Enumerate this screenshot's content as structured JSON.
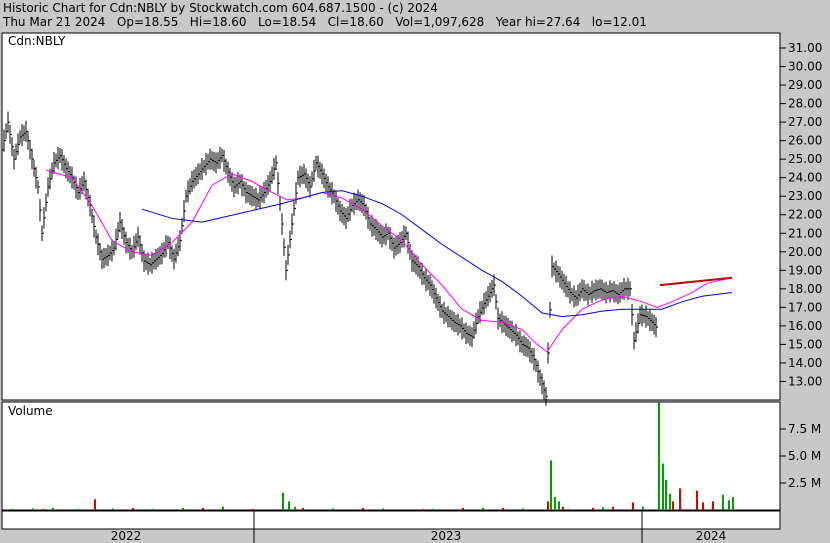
{
  "header": {
    "line1": "Historic Chart for Cdn:NBLY by Stockwatch.com 604.687.1500 - (c) 2024",
    "line2": "Thu Mar 21 2024   Op=18.55   Hi=18.60   Lo=18.54   Cl=18.60   Vol=1,097,628   Year hi=27.64   lo=12.01"
  },
  "panels": {
    "symbol": "Cdn:NBLY",
    "volume_label": "Volume"
  },
  "colors": {
    "background": "#c8c8c8",
    "panel": "#ffffff",
    "price_bars": "#000000",
    "ma_short": "#ff00ff",
    "ma_long": "#0000ff",
    "volume_up": "#00a000",
    "volume_down": "#e00000",
    "recent_range": "#c00000"
  },
  "chart_data": {
    "type": "bar",
    "title": "Historic Chart for Cdn:NBLY",
    "series": [
      {
        "kind": "ohlc",
        "points_xy": [
          [
            0,
            25.5
          ],
          [
            6,
            27.0
          ],
          [
            12,
            25.0
          ],
          [
            18,
            26.2
          ],
          [
            24,
            26.5
          ],
          [
            30,
            25.0
          ],
          [
            36,
            23.5
          ],
          [
            40,
            21.0
          ],
          [
            46,
            23.5
          ],
          [
            52,
            24.8
          ],
          [
            58,
            25.2
          ],
          [
            64,
            24.5
          ],
          [
            70,
            24.0
          ],
          [
            76,
            23.2
          ],
          [
            82,
            23.8
          ],
          [
            88,
            22.5
          ],
          [
            94,
            20.8
          ],
          [
            100,
            19.6
          ],
          [
            106,
            19.8
          ],
          [
            112,
            20.2
          ],
          [
            118,
            21.6
          ],
          [
            124,
            20.5
          ],
          [
            130,
            20.0
          ],
          [
            136,
            20.8
          ],
          [
            142,
            19.5
          ],
          [
            148,
            19.3
          ],
          [
            154,
            19.6
          ],
          [
            160,
            19.9
          ],
          [
            166,
            20.5
          ],
          [
            172,
            19.6
          ],
          [
            178,
            20.6
          ],
          [
            184,
            23.0
          ],
          [
            190,
            23.8
          ],
          [
            196,
            24.2
          ],
          [
            202,
            24.6
          ],
          [
            208,
            25.0
          ],
          [
            214,
            24.8
          ],
          [
            220,
            25.2
          ],
          [
            226,
            24.3
          ],
          [
            232,
            23.5
          ],
          [
            238,
            23.8
          ],
          [
            244,
            23.2
          ],
          [
            250,
            23.0
          ],
          [
            256,
            22.8
          ],
          [
            262,
            23.2
          ],
          [
            268,
            23.8
          ],
          [
            274,
            24.8
          ],
          [
            280,
            21.5
          ],
          [
            284,
            19.0
          ],
          [
            290,
            21.5
          ],
          [
            296,
            24.0
          ],
          [
            302,
            24.2
          ],
          [
            308,
            23.5
          ],
          [
            314,
            24.8
          ],
          [
            320,
            24.2
          ],
          [
            326,
            23.5
          ],
          [
            332,
            23.0
          ],
          [
            338,
            22.2
          ],
          [
            344,
            21.8
          ],
          [
            350,
            22.5
          ],
          [
            356,
            22.8
          ],
          [
            362,
            22.5
          ],
          [
            368,
            21.5
          ],
          [
            374,
            21.2
          ],
          [
            380,
            20.8
          ],
          [
            386,
            21.0
          ],
          [
            392,
            20.2
          ],
          [
            398,
            20.5
          ],
          [
            404,
            21.0
          ],
          [
            410,
            19.5
          ],
          [
            416,
            19.2
          ],
          [
            422,
            18.6
          ],
          [
            428,
            18.2
          ],
          [
            434,
            17.5
          ],
          [
            440,
            16.8
          ],
          [
            446,
            16.5
          ],
          [
            452,
            16.2
          ],
          [
            458,
            16.0
          ],
          [
            464,
            15.6
          ],
          [
            470,
            15.4
          ],
          [
            476,
            16.5
          ],
          [
            482,
            17.2
          ],
          [
            488,
            17.8
          ],
          [
            492,
            18.2
          ],
          [
            496,
            16.4
          ],
          [
            502,
            16.1
          ],
          [
            508,
            15.8
          ],
          [
            514,
            15.5
          ],
          [
            520,
            15.0
          ],
          [
            526,
            14.8
          ],
          [
            532,
            14.2
          ],
          [
            538,
            13.2
          ],
          [
            544,
            12.2
          ],
          [
            550,
            19.2
          ],
          [
            556,
            18.8
          ],
          [
            562,
            18.3
          ],
          [
            568,
            17.8
          ],
          [
            574,
            17.5
          ],
          [
            580,
            18.0
          ],
          [
            586,
            17.7
          ],
          [
            592,
            17.9
          ],
          [
            598,
            18.0
          ],
          [
            604,
            17.8
          ],
          [
            610,
            17.9
          ],
          [
            616,
            17.7
          ],
          [
            622,
            18.0
          ],
          [
            628,
            18.0
          ],
          [
            632,
            15.2
          ],
          [
            638,
            16.6
          ],
          [
            644,
            16.5
          ],
          [
            650,
            16.2
          ],
          [
            656,
            15.8
          ]
        ]
      },
      {
        "name": "",
        "kind": "moving_average_short",
        "points_xy": [
          [
            44,
            24.4
          ],
          [
            70,
            24.0
          ],
          [
            90,
            22.5
          ],
          [
            110,
            20.6
          ],
          [
            130,
            20.0
          ],
          [
            150,
            19.8
          ],
          [
            170,
            20.5
          ],
          [
            190,
            21.6
          ],
          [
            210,
            23.6
          ],
          [
            230,
            24.2
          ],
          [
            250,
            23.8
          ],
          [
            270,
            23.2
          ],
          [
            285,
            22.8
          ],
          [
            300,
            22.9
          ],
          [
            320,
            23.2
          ],
          [
            340,
            22.9
          ],
          [
            360,
            22.3
          ],
          [
            380,
            21.4
          ],
          [
            400,
            20.6
          ],
          [
            420,
            19.3
          ],
          [
            440,
            18.2
          ],
          [
            460,
            16.9
          ],
          [
            480,
            16.3
          ],
          [
            500,
            16.2
          ],
          [
            520,
            15.8
          ],
          [
            535,
            15.0
          ],
          [
            545,
            14.6
          ],
          [
            560,
            15.8
          ],
          [
            580,
            16.9
          ],
          [
            600,
            17.4
          ],
          [
            620,
            17.6
          ],
          [
            640,
            17.3
          ],
          [
            655,
            17.0
          ],
          [
            670,
            17.3
          ],
          [
            690,
            17.8
          ],
          [
            705,
            18.3
          ],
          [
            730,
            18.6
          ]
        ]
      },
      {
        "name": "",
        "kind": "moving_average_long",
        "points_xy": [
          [
            140,
            22.3
          ],
          [
            170,
            21.8
          ],
          [
            200,
            21.6
          ],
          [
            240,
            22.1
          ],
          [
            280,
            22.6
          ],
          [
            320,
            23.2
          ],
          [
            340,
            23.3
          ],
          [
            360,
            23.0
          ],
          [
            380,
            22.6
          ],
          [
            400,
            22.0
          ],
          [
            420,
            21.2
          ],
          [
            440,
            20.4
          ],
          [
            460,
            19.7
          ],
          [
            480,
            19.0
          ],
          [
            500,
            18.4
          ],
          [
            520,
            17.6
          ],
          [
            540,
            16.7
          ],
          [
            560,
            16.5
          ],
          [
            580,
            16.6
          ],
          [
            600,
            16.8
          ],
          [
            620,
            16.9
          ],
          [
            640,
            16.9
          ],
          [
            660,
            16.9
          ],
          [
            680,
            17.3
          ],
          [
            700,
            17.6
          ],
          [
            730,
            17.8
          ]
        ]
      },
      {
        "name": "",
        "kind": "recent_range",
        "points_xy": [
          [
            658,
            18.2
          ],
          [
            730,
            18.6
          ]
        ]
      }
    ],
    "volume": {
      "y_ticks": [
        "2.5 M",
        "5.0 M",
        "7.5 M"
      ],
      "y_values": [
        2.5,
        5.0,
        7.5
      ],
      "ylim": [
        0,
        10
      ],
      "bars_xy_up": [
        [
          10,
          0.1
        ],
        [
          30,
          0.15
        ],
        [
          50,
          0.2
        ],
        [
          75,
          0.1
        ],
        [
          110,
          0.15
        ],
        [
          150,
          0.1
        ],
        [
          180,
          0.2
        ],
        [
          220,
          0.3
        ],
        [
          280,
          1.6
        ],
        [
          286,
          0.8
        ],
        [
          292,
          0.3
        ],
        [
          330,
          0.15
        ],
        [
          380,
          0.15
        ],
        [
          430,
          0.1
        ],
        [
          480,
          0.2
        ],
        [
          520,
          0.15
        ],
        [
          548,
          4.6
        ],
        [
          552,
          1.2
        ],
        [
          556,
          0.8
        ],
        [
          600,
          0.25
        ],
        [
          640,
          0.3
        ],
        [
          656,
          10.0
        ],
        [
          660,
          4.3
        ],
        [
          663,
          2.8
        ],
        [
          667,
          1.5
        ],
        [
          720,
          1.4
        ],
        [
          726,
          0.9
        ],
        [
          730,
          1.2
        ]
      ],
      "bars_xy_down": [
        [
          40,
          0.1
        ],
        [
          92,
          1.0
        ],
        [
          130,
          0.2
        ],
        [
          200,
          0.2
        ],
        [
          250,
          0.1
        ],
        [
          300,
          0.2
        ],
        [
          360,
          0.2
        ],
        [
          420,
          0.1
        ],
        [
          460,
          0.2
        ],
        [
          500,
          0.2
        ],
        [
          545,
          0.8
        ],
        [
          560,
          0.3
        ],
        [
          590,
          0.2
        ],
        [
          610,
          0.3
        ],
        [
          630,
          0.7
        ],
        [
          670,
          0.8
        ],
        [
          677,
          2.0
        ],
        [
          694,
          1.8
        ],
        [
          700,
          0.7
        ],
        [
          710,
          0.8
        ]
      ]
    },
    "y_ticks": [
      "13.00",
      "14.00",
      "15.00",
      "16.00",
      "17.00",
      "18.00",
      "19.00",
      "20.00",
      "21.00",
      "22.00",
      "23.00",
      "24.00",
      "25.00",
      "26.00",
      "27.00",
      "28.00",
      "29.00",
      "30.00",
      "31.00"
    ],
    "y_values": [
      13,
      14,
      15,
      16,
      17,
      18,
      19,
      20,
      21,
      22,
      23,
      24,
      25,
      26,
      27,
      28,
      29,
      30,
      31
    ],
    "ylim": [
      12,
      31.9
    ],
    "x_labels": [
      "2022",
      "2023",
      "2024"
    ],
    "xlim": [
      0,
      780
    ],
    "grid": false
  }
}
